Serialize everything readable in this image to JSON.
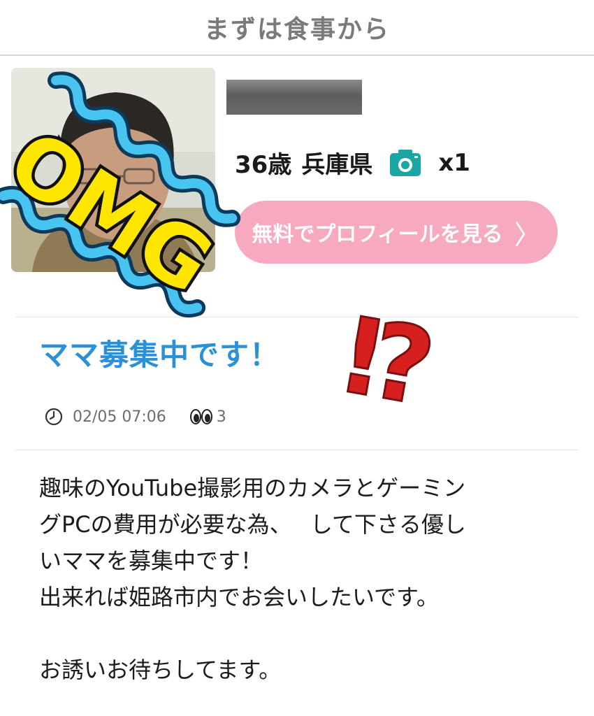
{
  "header": {
    "title": "まずは食事から"
  },
  "profile": {
    "age": "36歳",
    "location": "兵庫県",
    "photo_count": "x1",
    "cta_label": "無料でプロフィールを見る",
    "cta_chevron": "〉",
    "camera_icon": "camera-icon",
    "avatar_icon": "person-photo"
  },
  "post": {
    "title": "ママ募集中です！",
    "date": "02/05 07:06",
    "views": "3",
    "body_lines": [
      "趣味のYouTube撮影用のカメラとゲーミン",
      "グPCの費用が必要な為、　 して下さる優し",
      "いママを募集中です！",
      "出来れば姫路市内でお会いしたいです。"
    ],
    "closing": "お誘いお待ちしてます。"
  },
  "overlay": {
    "omg": "OMG",
    "exclaim": "⁉"
  },
  "colors": {
    "accent_blue": "#2a91d8",
    "cta_pink": "#f7a9bf",
    "teal": "#1ba6a6",
    "omg_yellow": "#ffe600",
    "squiggle_blue": "#48c4f0",
    "exclaim_red": "#d6201f"
  }
}
